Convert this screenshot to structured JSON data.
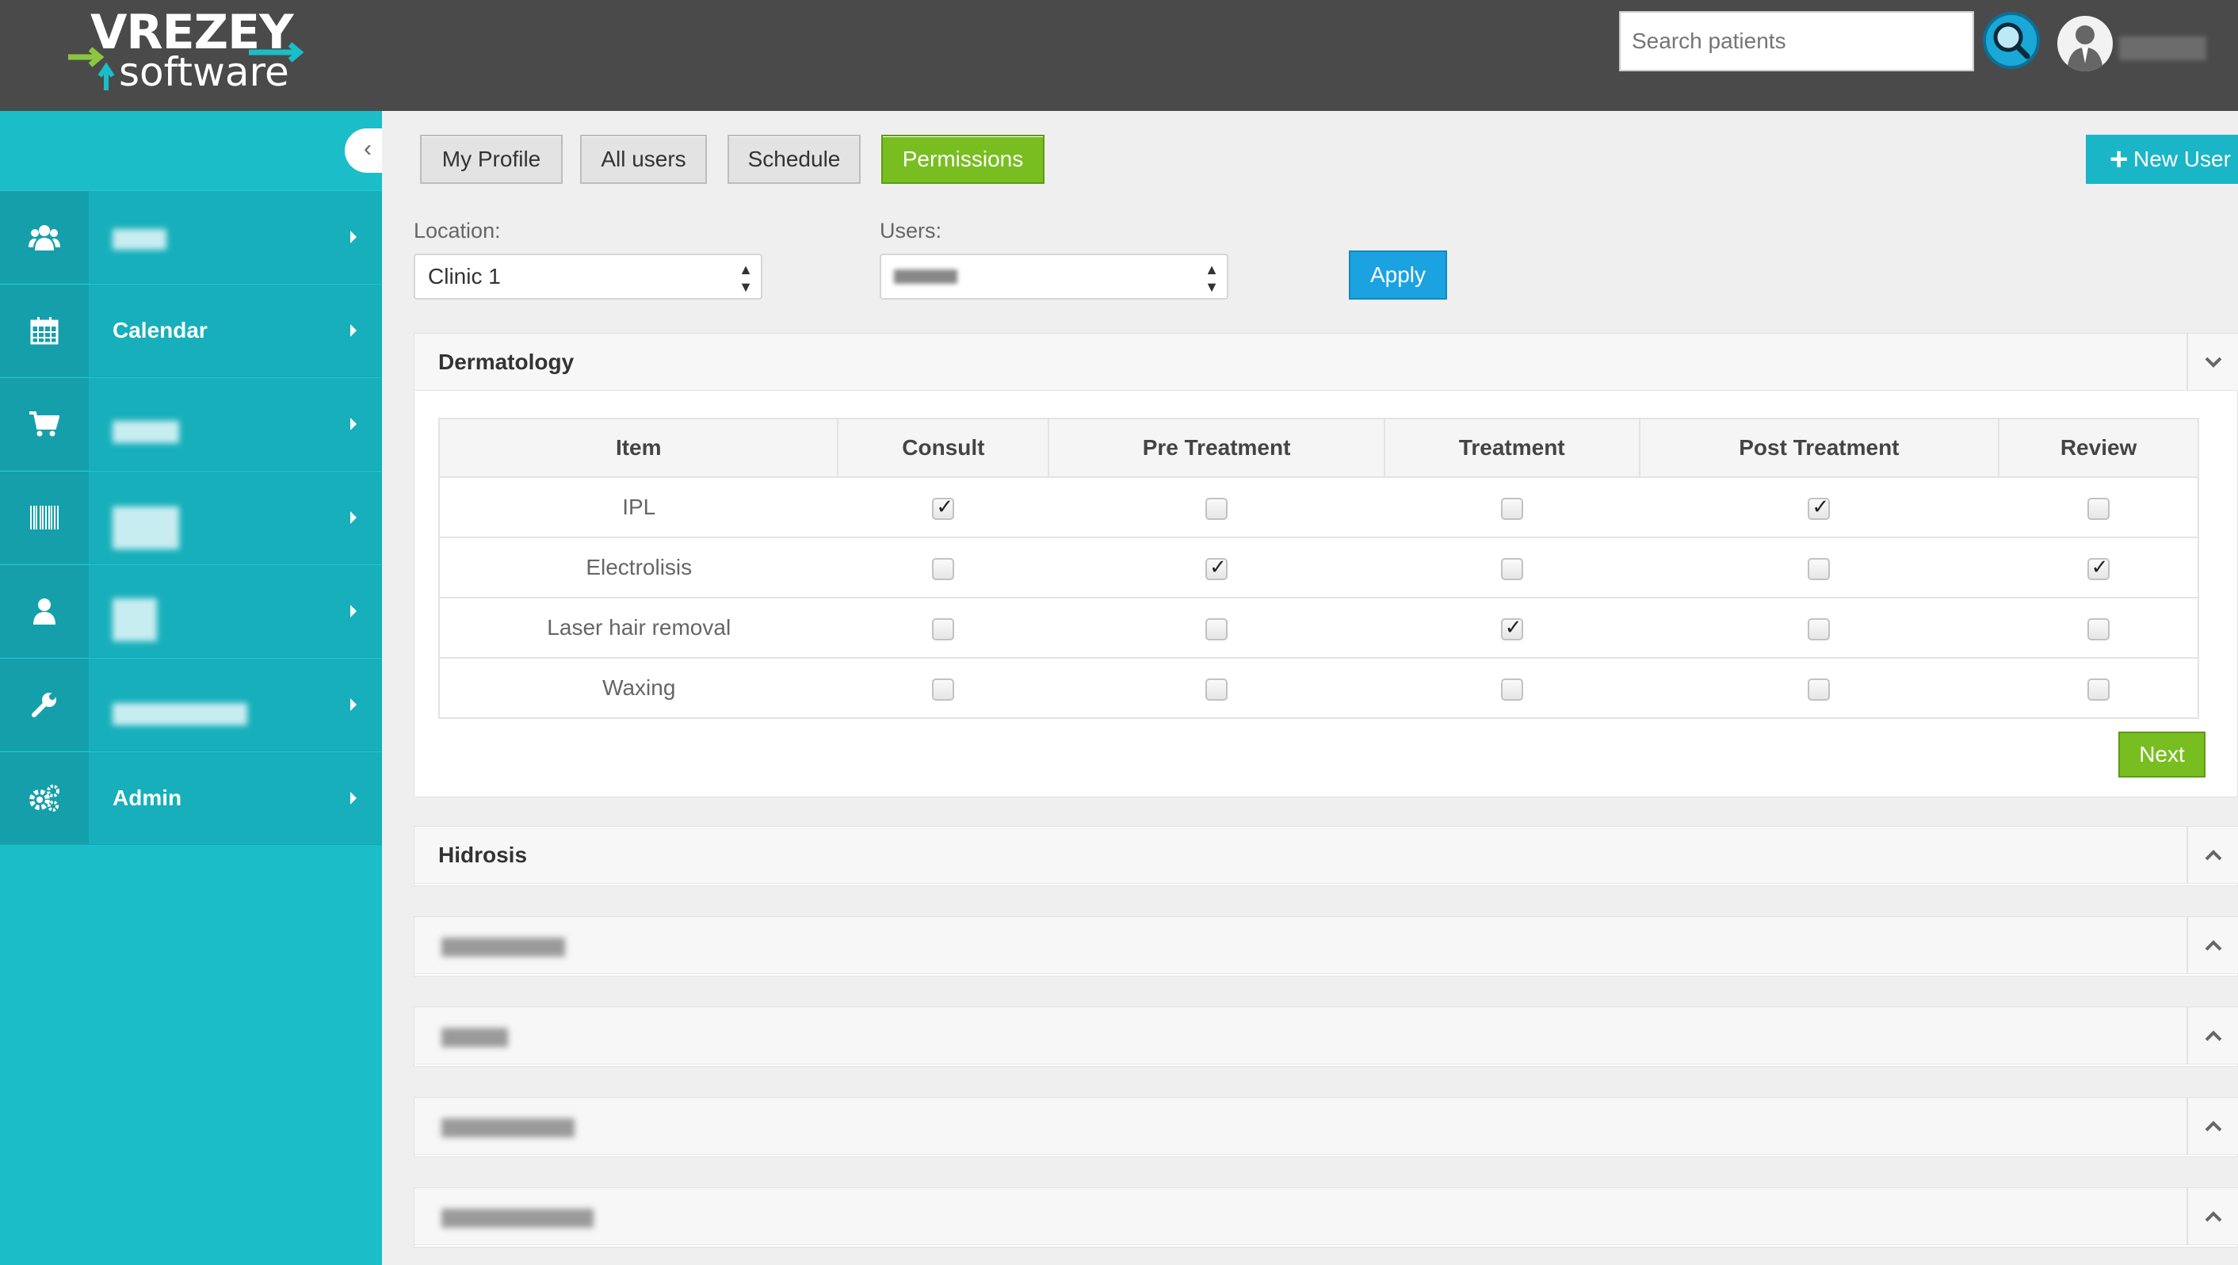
{
  "app": {
    "logo_top": "VREZEY",
    "logo_bottom": "software",
    "accent_color": "#1bbdc9",
    "active_color": "#78be20"
  },
  "header": {
    "search_placeholder": "Search patients",
    "search_icon": "magnifier-icon",
    "avatar_icon": "user-avatar-icon"
  },
  "sidebar": {
    "collapse_icon": "chevron-left-icon",
    "items": [
      {
        "icon": "users-icon",
        "label": ""
      },
      {
        "icon": "calendar-icon",
        "label": "Calendar"
      },
      {
        "icon": "cart-icon",
        "label": ""
      },
      {
        "icon": "barcode-icon",
        "label": ""
      },
      {
        "icon": "user-icon",
        "label": ""
      },
      {
        "icon": "wrench-icon",
        "label": ""
      },
      {
        "icon": "gears-icon",
        "label": "Admin"
      }
    ]
  },
  "tabs": [
    {
      "label": "My Profile",
      "active": false
    },
    {
      "label": "All users",
      "active": false
    },
    {
      "label": "Schedule",
      "active": false
    },
    {
      "label": "Permissions",
      "active": true
    }
  ],
  "new_user_label": "New User",
  "filters": {
    "location_label": "Location:",
    "location_value": "Clinic 1",
    "users_label": "Users:",
    "users_value": "",
    "apply_label": "Apply"
  },
  "panels": [
    {
      "title": "Dermatology",
      "expanded": true,
      "columns": [
        "Item",
        "Consult",
        "Pre Treatment",
        "Treatment",
        "Post Treatment",
        "Review"
      ],
      "rows": [
        {
          "item": "IPL",
          "checks": [
            true,
            false,
            false,
            true,
            false
          ]
        },
        {
          "item": "Electrolisis",
          "checks": [
            false,
            true,
            false,
            false,
            true
          ]
        },
        {
          "item": "Laser hair removal",
          "checks": [
            false,
            false,
            true,
            false,
            false
          ]
        },
        {
          "item": "Waxing",
          "checks": [
            false,
            false,
            false,
            false,
            false
          ]
        }
      ],
      "next_label": "Next"
    },
    {
      "title": "Hidrosis",
      "expanded": false
    },
    {
      "title": "",
      "expanded": false
    },
    {
      "title": "",
      "expanded": false
    },
    {
      "title": "",
      "expanded": false
    },
    {
      "title": "",
      "expanded": false
    }
  ]
}
